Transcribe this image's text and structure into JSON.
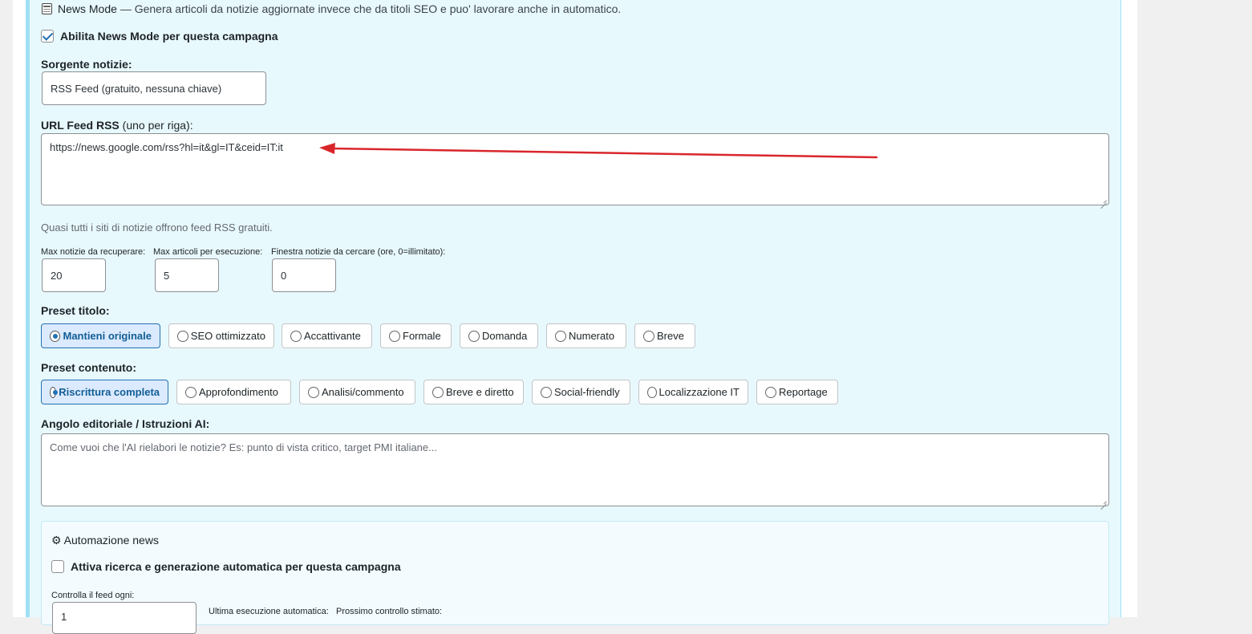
{
  "header": {
    "icon": "newspaper-icon",
    "title": "News Mode",
    "description": "— Genera articoli da notizie aggiornate invece che da titoli SEO e puo' lavorare anche in automatico."
  },
  "enable_news_mode": {
    "label": "Abilita News Mode per questa campagna",
    "checked": true
  },
  "source": {
    "label": "Sorgente notizie:",
    "value": "RSS Feed (gratuito, nessuna chiave)"
  },
  "rss_urls": {
    "label": "URL Feed RSS",
    "label_hint": "(uno per riga):",
    "value": "https://news.google.com/rss?hl=it&gl=IT&ceid=IT:it",
    "help": "Quasi tutti i siti di notizie offrono feed RSS gratuiti."
  },
  "limits": {
    "max_news": {
      "label": "Max notizie da recuperare:",
      "value": "20"
    },
    "max_articles": {
      "label": "Max articoli per esecuzione:",
      "value": "5"
    },
    "window": {
      "label": "Finestra notizie da cercare (ore, 0=illimitato):",
      "value": "0"
    }
  },
  "title_preset": {
    "label": "Preset titolo:",
    "options": [
      "Mantieni originale",
      "SEO ottimizzato",
      "Accattivante",
      "Formale",
      "Domanda",
      "Numerato",
      "Breve"
    ],
    "selected": "Mantieni originale"
  },
  "content_preset": {
    "label": "Preset contenuto:",
    "options": [
      "Riscrittura completa",
      "Approfondimento",
      "Analisi/commento",
      "Breve e diretto",
      "Social-friendly",
      "Localizzazione IT",
      "Reportage"
    ],
    "selected": "Riscrittura completa"
  },
  "editorial": {
    "label": "Angolo editoriale / Istruzioni AI:",
    "placeholder": "Come vuoi che l'AI rielabori le notizie? Es: punto di vista critico, target PMI italiane..."
  },
  "automation": {
    "title": "⚙ Automazione news",
    "enable_label": "Attiva ricerca e generazione automatica per questa campagna",
    "enabled": false,
    "check_every_label": "Controlla il feed ogni:",
    "check_every_value": "1",
    "last_run_label": "Ultima esecuzione automatica:",
    "next_check_label": "Prossimo controllo stimato:"
  },
  "annotation": {
    "color": "#d9262c"
  }
}
